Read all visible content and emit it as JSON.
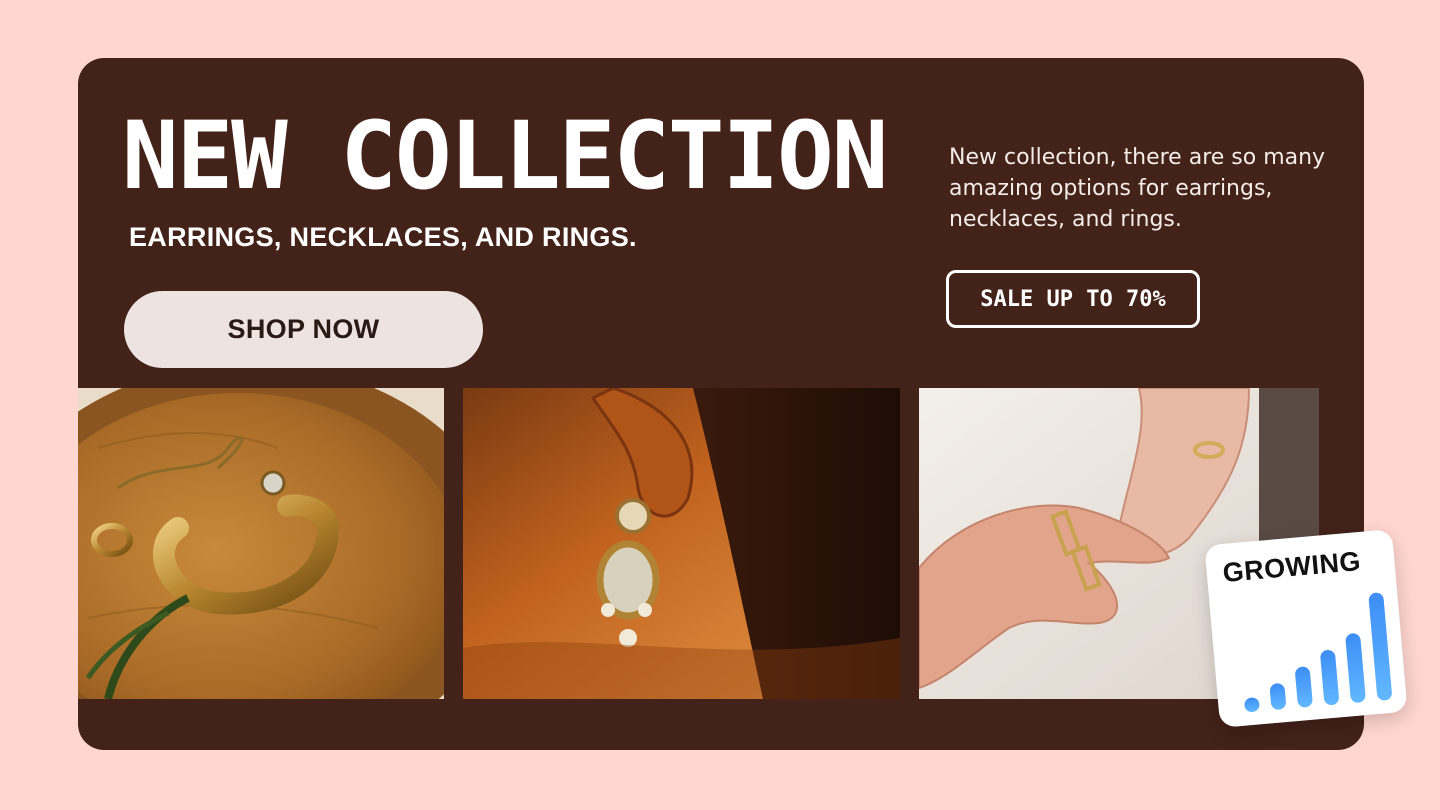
{
  "banner": {
    "title": "NEW COLLECTION",
    "subtitle": "EARRINGS, NECKLACES, AND RINGS.",
    "shop_button": "SHOP NOW",
    "description": "New collection, there are so many amazing options for earrings, necklaces, and rings.",
    "sale_tag": "SALE UP TO 70%"
  },
  "badge": {
    "label": "GROWING",
    "bar_levels": [
      0.12,
      0.22,
      0.34,
      0.46,
      0.58,
      0.9
    ]
  },
  "colors": {
    "page_bg": "#ffd6d0",
    "card_bg": "#43221a",
    "button_bg": "#ede4e1",
    "bar_gradient_top": "#3d8df5",
    "bar_gradient_bottom": "#62b8ff"
  }
}
